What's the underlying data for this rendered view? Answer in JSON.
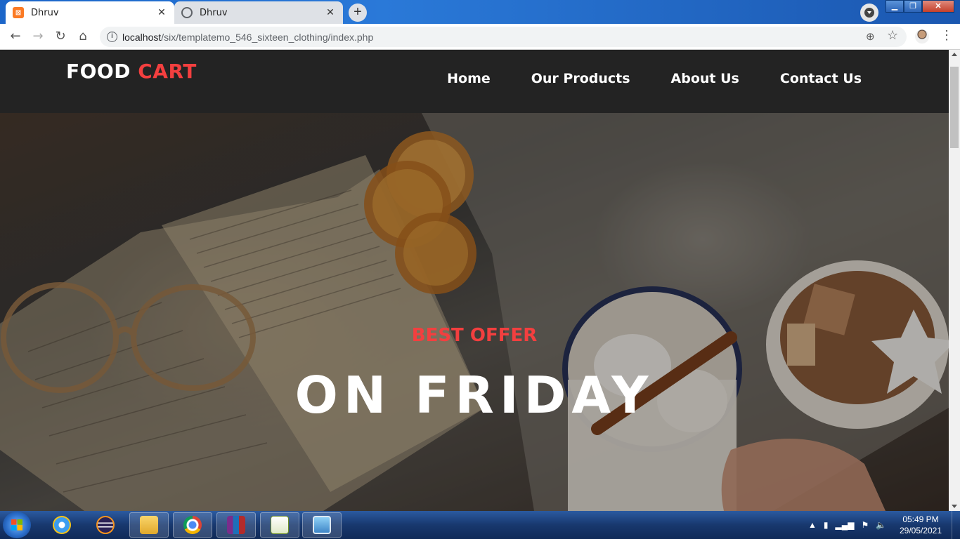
{
  "browser": {
    "tabs": [
      {
        "title": "Dhruv",
        "active": true,
        "favicon": "xampp-icon"
      },
      {
        "title": "Dhruv",
        "active": false,
        "favicon": "globe-icon"
      }
    ],
    "new_tab_label": "+",
    "url_host": "localhost",
    "url_path": "/six/templatemo_546_sixteen_clothing/index.php"
  },
  "site": {
    "logo_part1": "FOOD",
    "logo_part2": "CART",
    "nav": [
      "Home",
      "Our Products",
      "About Us",
      "Contact Us"
    ],
    "hero_subtitle": "BEST OFFER",
    "hero_title": "ON FRIDAY",
    "accent_color": "#f33f3f",
    "header_bg": "#232323"
  },
  "taskbar": {
    "apps": [
      "internet-explorer-icon",
      "eclipse-icon",
      "file-explorer-icon",
      "chrome-icon",
      "winrar-icon",
      "notepad-icon",
      "image-viewer-icon"
    ],
    "time": "05:49 PM",
    "date": "29/05/2021"
  }
}
